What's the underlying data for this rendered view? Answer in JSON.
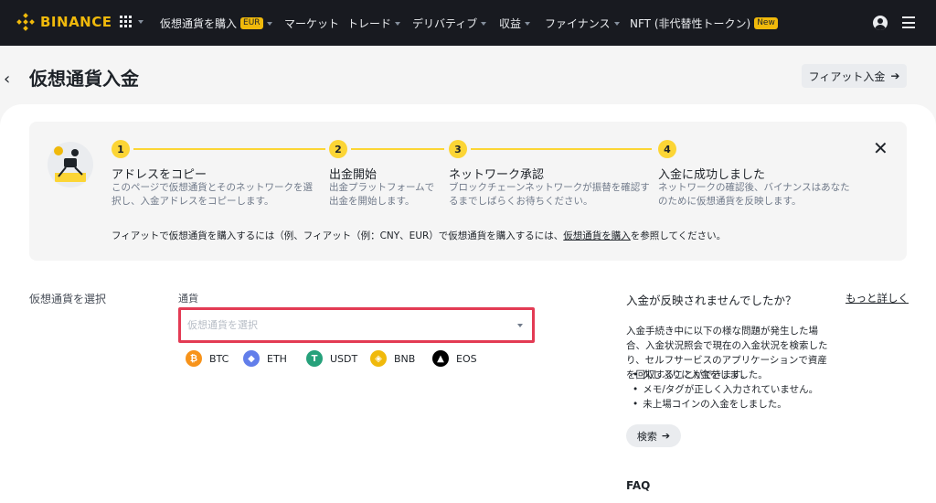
{
  "nav": {
    "brand": "BINANCE",
    "items": [
      {
        "label": "仮想通貨を購入",
        "tag": "EUR"
      },
      {
        "label": "マーケット"
      },
      {
        "label": "トレード"
      },
      {
        "label": "デリバティブ"
      },
      {
        "label": "収益"
      },
      {
        "label": "ファイナンス"
      },
      {
        "label": "NFT (非代替性トークン)",
        "tag": "New"
      }
    ],
    "user_icon": "user-icon",
    "menu_icon": "hamburger-menu-icon"
  },
  "page": {
    "title": "仮想通貨入金",
    "fiat_button": "フィアット入金"
  },
  "steps": [
    {
      "num": "1",
      "title": "アドレスをコピー",
      "desc": "このページで仮想通貨とそのネットワークを選択し、入金アドレスをコピーします。"
    },
    {
      "num": "2",
      "title": "出金開始",
      "desc": "出金プラットフォームで出金を開始します。"
    },
    {
      "num": "3",
      "title": "ネットワーク承認",
      "desc": "ブロックチェーンネットワークが振替を確認するまでしばらくお待ちください。"
    },
    {
      "num": "4",
      "title": "入金に成功しました",
      "desc": "ネットワークの確認後、バイナンスはあなたのために仮想通貨を反映します。"
    }
  ],
  "fiat_note": {
    "prefix": "フィアットで仮想通貨を購入するには（例、フィアット（例：CNY、EUR）で仮想通貨を購入するには、",
    "link": "仮想通貨を購入",
    "suffix": "を参照してください。"
  },
  "select": {
    "section_label": "仮想通貨を選択",
    "field_label": "通貨",
    "placeholder": "仮想通貨を選択"
  },
  "coins": [
    {
      "symbol": "BTC",
      "glyph": "₿",
      "color": "#f7931a"
    },
    {
      "symbol": "ETH",
      "glyph": "◆",
      "color": "#627eea"
    },
    {
      "symbol": "USDT",
      "glyph": "T",
      "color": "#26a17b"
    },
    {
      "symbol": "BNB",
      "glyph": "◈",
      "color": "#f0b90b"
    },
    {
      "symbol": "EOS",
      "glyph": "▲",
      "color": "#000000"
    }
  ],
  "help": {
    "title": "入金が反映されませんでしたか？",
    "more_link": "もっと詳しく",
    "desc": "入金手続き中に以下の様な問題が発生した場合、入金状況照会で現在の入金状況を検索したり、セルフサービスのアプリケーションで資産を回収することができます。",
    "items": [
      "久しぶりに入金をしました。",
      "メモ/タグが正しく入力されていません。",
      "未上場コインの入金をしました。"
    ],
    "search_button": "検索"
  },
  "faq": "FAQ",
  "colors": {
    "brand": "#f0b90b",
    "step": "#fcd535",
    "highlight": "#e33b54",
    "nav_bg": "#181a20"
  }
}
